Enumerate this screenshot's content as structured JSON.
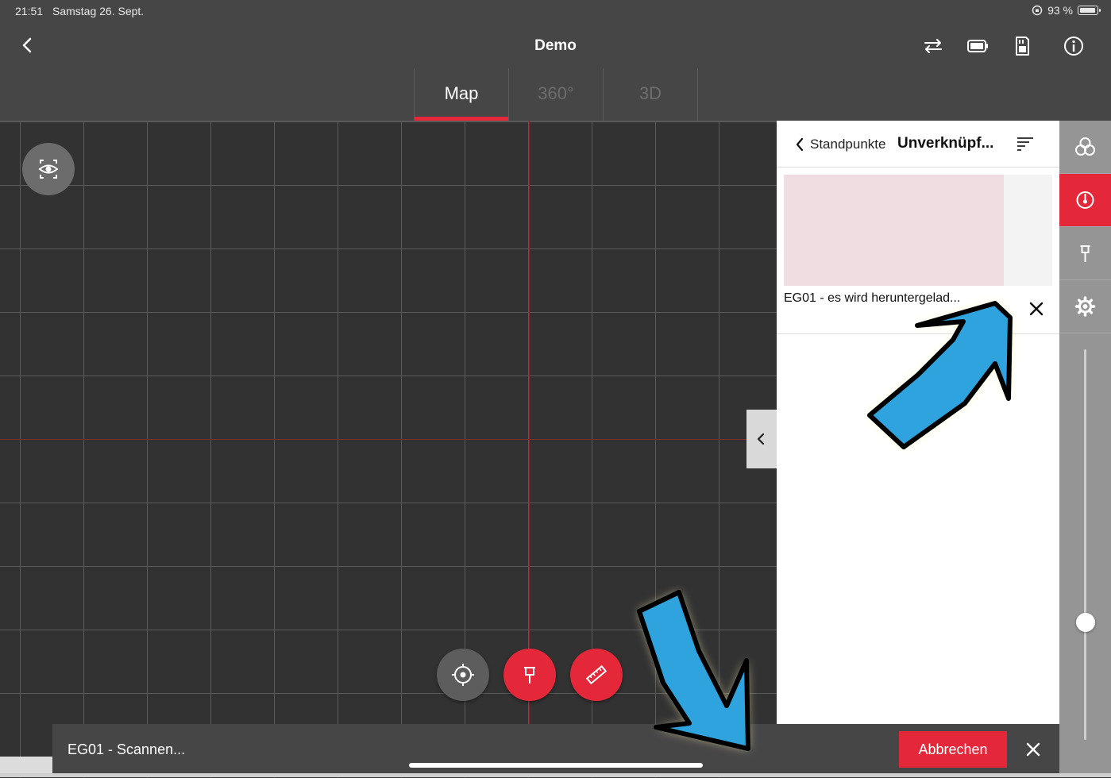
{
  "status_bar": {
    "time": "21:51",
    "date": "Samstag 26. Sept.",
    "battery": "93 %"
  },
  "header": {
    "title": "Demo",
    "icons": [
      "back-icon",
      "swap-icon",
      "battery-icon",
      "sd-card-icon",
      "info-icon"
    ]
  },
  "tabs": [
    {
      "label": "Map",
      "active": true
    },
    {
      "label": "360°",
      "active": false
    },
    {
      "label": "3D",
      "active": false
    }
  ],
  "panel": {
    "breadcrumb": "Standpunkte",
    "title": "Unverknüpf...",
    "item": {
      "label": "EG01 - es wird heruntergelad...",
      "download_progress": 0.82
    }
  },
  "map_buttons": [
    "view-icon",
    "locate-icon",
    "pin-icon",
    "measure-icon"
  ],
  "right_toolbar": [
    "layers-icon",
    "compass-icon",
    "pin-icon",
    "settings-icon"
  ],
  "slider": {
    "value": 0.3
  },
  "bottom_bar": {
    "status": "EG01 - Scannen...",
    "cancel_label": "Abbrechen"
  },
  "colors": {
    "accent": "#e4283a",
    "header_bg": "#474647",
    "map_bg": "#333233",
    "annotation_arrow": "#2fa3dd"
  }
}
